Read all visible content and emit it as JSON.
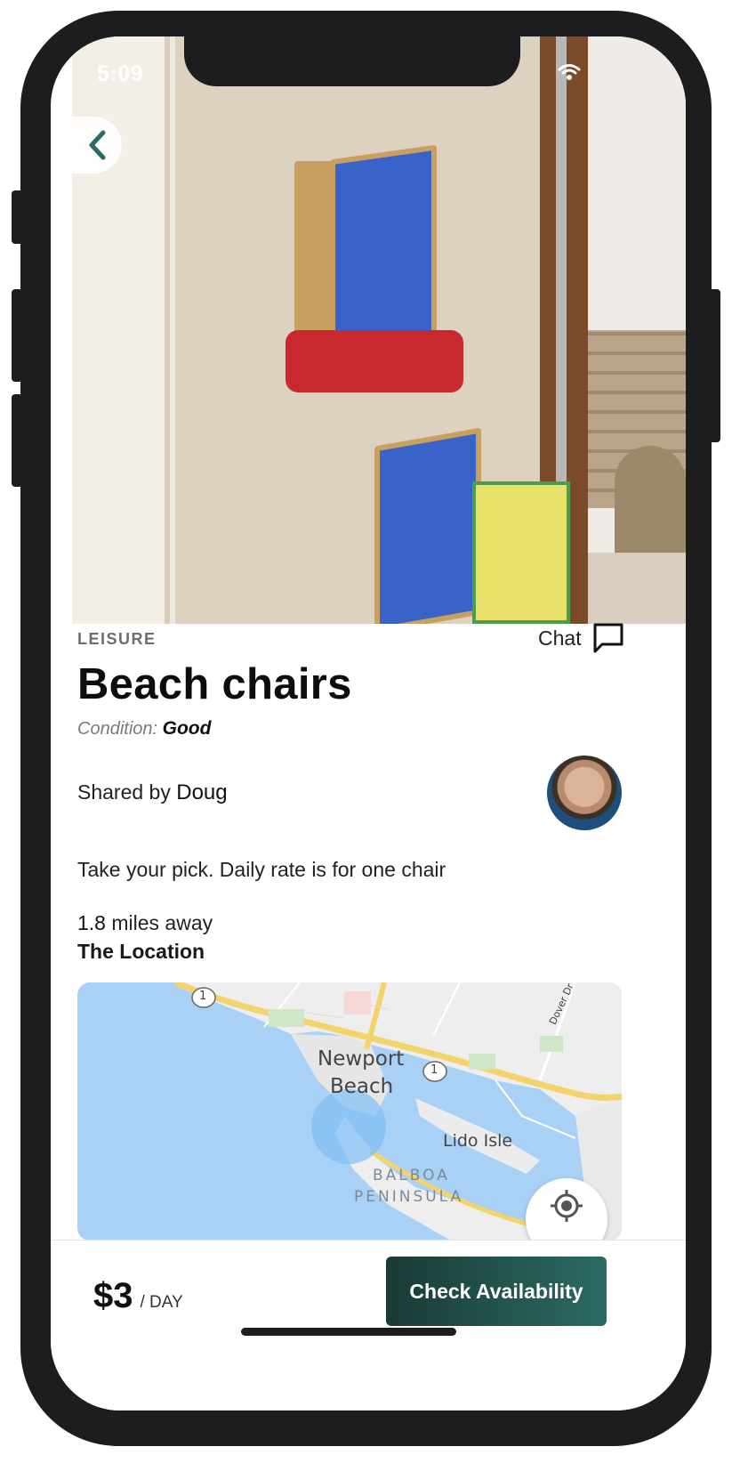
{
  "status_bar": {
    "time": "5:09"
  },
  "item": {
    "category": "LEISURE",
    "title": "Beach chairs",
    "condition_label": "Condition:",
    "condition_value": "Good",
    "shared_by_label": "Shared by",
    "owner_name": "Doug",
    "description": "Take your pick. Daily rate is for one chair",
    "distance_value": "1.8",
    "distance_unit": "miles away",
    "location_title": "The Location"
  },
  "chat": {
    "label": "Chat"
  },
  "map": {
    "labels": {
      "newport_1": "Newport",
      "newport_2": "Beach",
      "lido": "Lido Isle",
      "balboa_1": "BALBOA",
      "balboa_2": "PENINSULA",
      "dover": "Dover Dr",
      "route": "1"
    },
    "colors": {
      "water": "#a9d1f5",
      "land": "#eeeeee",
      "highway": "#f3d36b",
      "circle": "#7fbff5"
    }
  },
  "footer": {
    "price": "$3",
    "price_unit": "/ DAY",
    "cta_label": "Check Availability"
  },
  "icons": [
    "chevron-left-icon",
    "wifi-icon",
    "chat-bubble-icon",
    "my-location-icon"
  ],
  "colors": {
    "accent": "#2b6b63",
    "accent_dark": "#1a3a36",
    "frame": "#1d1d1f"
  }
}
